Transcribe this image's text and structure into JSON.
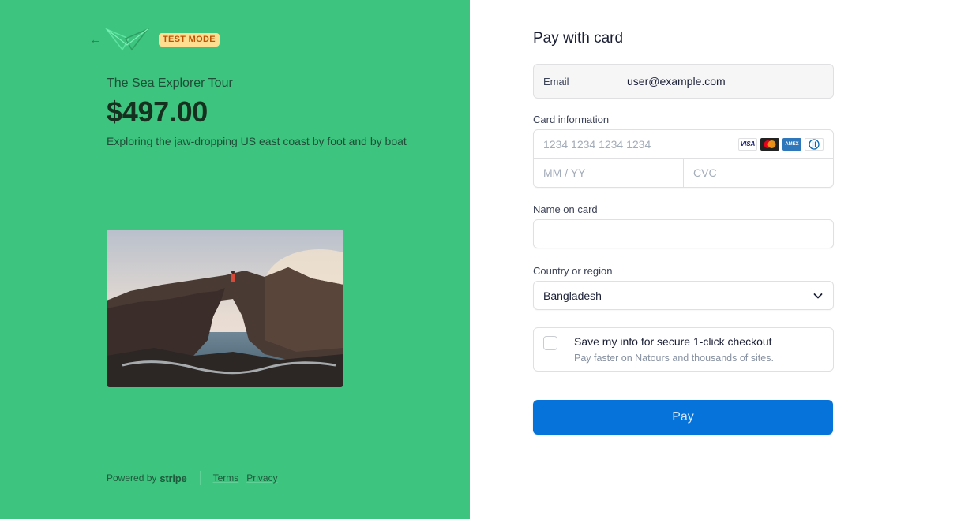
{
  "left": {
    "badge": "TEST MODE",
    "product_name": "The Sea Explorer Tour",
    "price": "$497.00",
    "description": "Exploring the jaw-dropping US east coast by foot and by boat",
    "footer": {
      "powered_by": "Powered by",
      "stripe": "stripe",
      "terms": "Terms",
      "privacy": "Privacy"
    },
    "colors": {
      "background": "#3dc47e",
      "badge_bg": "#ffde92",
      "badge_text": "#bb5504"
    }
  },
  "form": {
    "title": "Pay with card",
    "email_label": "Email",
    "email_value": "user@example.com",
    "card_label": "Card information",
    "card_number_placeholder": "1234 1234 1234 1234",
    "expiry_placeholder": "MM / YY",
    "cvc_placeholder": "CVC",
    "card_brands": [
      "visa-icon",
      "mastercard-icon",
      "amex-icon",
      "diners-icon"
    ],
    "visa_text": "VISA",
    "amex_text": "AMEX",
    "name_label": "Name on card",
    "name_value": "",
    "country_label": "Country or region",
    "country_value": "Bangladesh",
    "save_title": "Save my info for secure 1-click checkout",
    "save_subtitle": "Pay faster on Natours and thousands of sites.",
    "save_checked": false,
    "pay_label": "Pay",
    "colors": {
      "pay_button": "#0573d9"
    }
  }
}
